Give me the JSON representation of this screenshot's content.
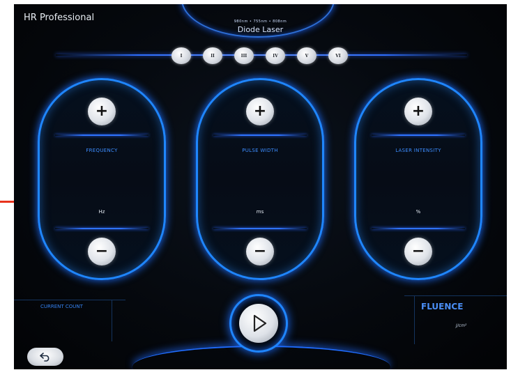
{
  "header": {
    "app_title": "HR Professional",
    "brand_small": "980nm • 755nm • 808nm",
    "brand_name": "Diode Laser"
  },
  "modes": [
    "I",
    "II",
    "III",
    "IV",
    "V",
    "VI"
  ],
  "params": [
    {
      "label": "FREQUENCY",
      "value": "",
      "unit": "Hz"
    },
    {
      "label": "PULSE WIDTH",
      "value": "",
      "unit": "ms"
    },
    {
      "label": "LASER INTENSITY",
      "value": "",
      "unit": "%"
    }
  ],
  "bottom": {
    "count_label": "CURRENT COUNT",
    "count_value": "",
    "fluence_label": "FLUENCE",
    "fluence_value": "",
    "fluence_unit": "J/cm²"
  },
  "icons": {
    "plus": "+",
    "minus": "−",
    "play": "play-icon",
    "back": "back-arrow-icon"
  },
  "colors": {
    "accent": "#1f86ff",
    "label": "#3d8dff",
    "background": "#05080d"
  }
}
